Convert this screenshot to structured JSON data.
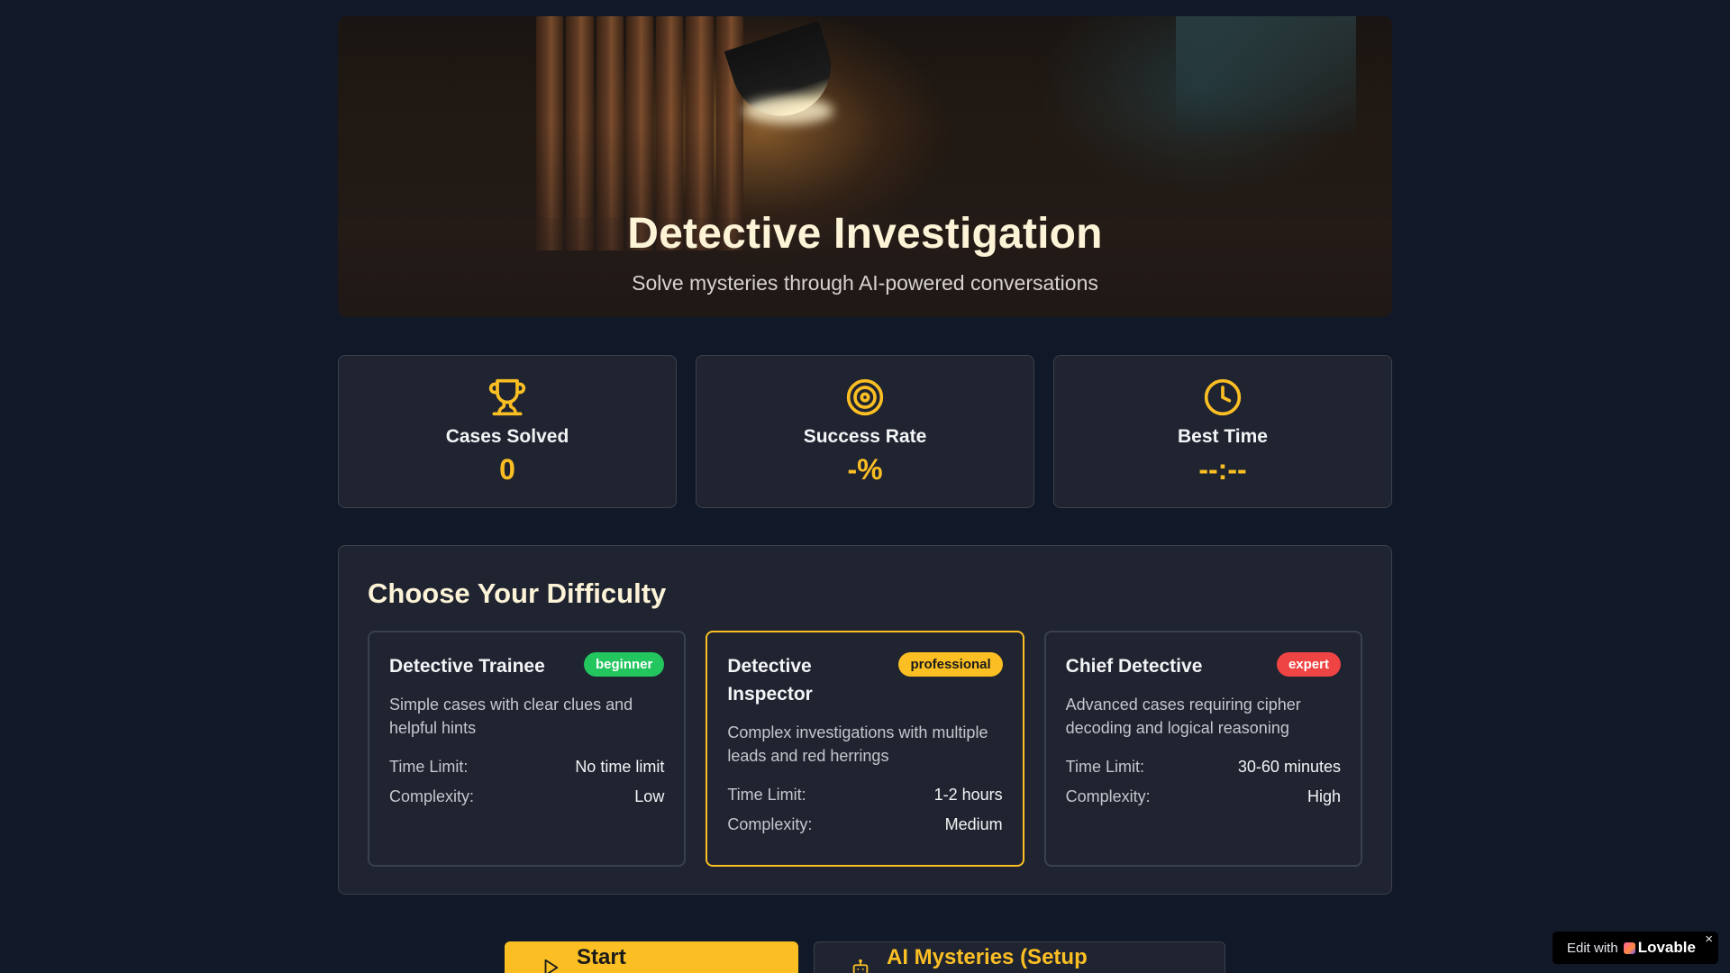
{
  "hero": {
    "title": "Detective Investigation",
    "subtitle": "Solve mysteries through AI-powered conversations"
  },
  "stats": [
    {
      "icon": "trophy-icon",
      "label": "Cases Solved",
      "value": "0"
    },
    {
      "icon": "target-icon",
      "label": "Success Rate",
      "value": "-%"
    },
    {
      "icon": "clock-icon",
      "label": "Best Time",
      "value": "--:--"
    }
  ],
  "difficulty": {
    "title": "Choose Your Difficulty",
    "levels": [
      {
        "name": "Detective Trainee",
        "badge": "beginner",
        "description": "Simple cases with clear clues and helpful hints",
        "time_label": "Time Limit:",
        "time_value": "No time limit",
        "complexity_label": "Complexity:",
        "complexity_value": "Low",
        "selected": false
      },
      {
        "name": "Detective Inspector",
        "badge": "professional",
        "description": "Complex investigations with multiple leads and red herrings",
        "time_label": "Time Limit:",
        "time_value": "1-2 hours",
        "complexity_label": "Complexity:",
        "complexity_value": "Medium",
        "selected": true
      },
      {
        "name": "Chief Detective",
        "badge": "expert",
        "description": "Advanced cases requiring cipher decoding and logical reasoning",
        "time_label": "Time Limit:",
        "time_value": "30-60 minutes",
        "complexity_label": "Complexity:",
        "complexity_value": "High",
        "selected": false
      }
    ]
  },
  "actions": {
    "start_label": "Start Investigation",
    "ai_label": "AI Mysteries (Setup Required)"
  },
  "lovable": {
    "prefix": "Edit with",
    "brand": "Lovable",
    "close": "×"
  },
  "colors": {
    "accent": "#fbbf24",
    "background": "#111827",
    "card": "#1f2430",
    "beginner": "#22c55e",
    "expert": "#ef4444"
  }
}
